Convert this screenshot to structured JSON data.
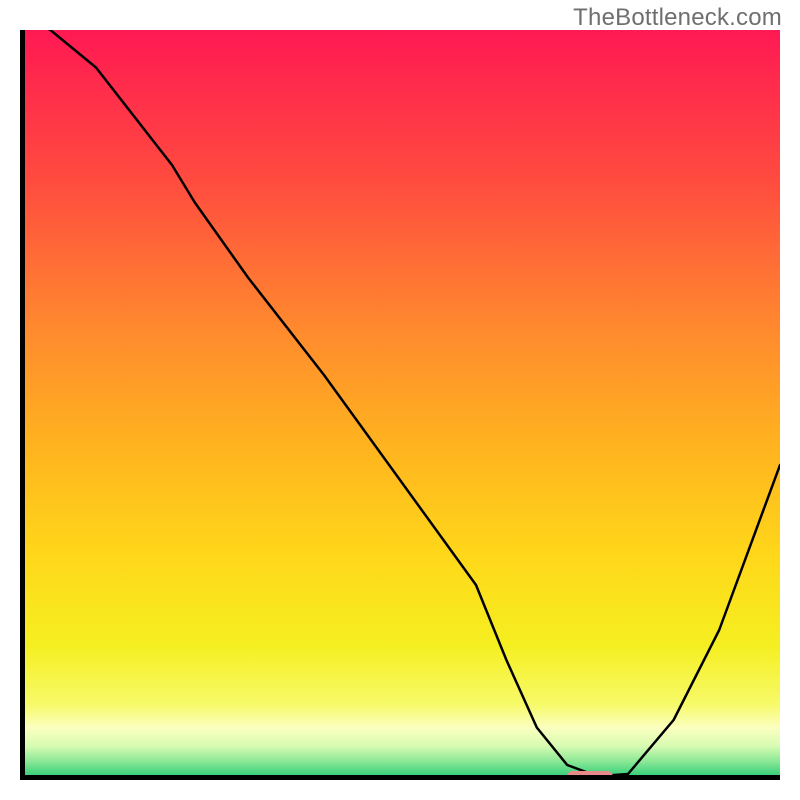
{
  "watermark": "TheBottleneck.com",
  "chart_data": {
    "type": "line",
    "title": "",
    "xlabel": "",
    "ylabel": "",
    "xlim": [
      0,
      100
    ],
    "ylim": [
      0,
      100
    ],
    "grid": false,
    "legend": false,
    "background": {
      "type": "vertical-gradient",
      "stops": [
        {
          "pos": 0.0,
          "color": "#ff1953"
        },
        {
          "pos": 0.2,
          "color": "#ff4b3f"
        },
        {
          "pos": 0.4,
          "color": "#ff8a2e"
        },
        {
          "pos": 0.55,
          "color": "#ffb21f"
        },
        {
          "pos": 0.7,
          "color": "#ffd71a"
        },
        {
          "pos": 0.82,
          "color": "#f5ef20"
        },
        {
          "pos": 0.9,
          "color": "#f7fa6a"
        },
        {
          "pos": 0.93,
          "color": "#fbffc0"
        },
        {
          "pos": 0.955,
          "color": "#d7fbb2"
        },
        {
          "pos": 0.975,
          "color": "#8be896"
        },
        {
          "pos": 1.0,
          "color": "#1ec771"
        }
      ]
    },
    "series": [
      {
        "name": "bottleneck-curve",
        "color": "#000000",
        "width": 2.5,
        "x": [
          0,
          4,
          10,
          20,
          23,
          30,
          40,
          50,
          60,
          64,
          68,
          72,
          76,
          80,
          86,
          92,
          100
        ],
        "y": [
          102,
          100,
          95,
          82,
          77,
          67,
          54,
          40,
          26,
          16,
          7,
          2,
          0.5,
          0.8,
          8,
          20,
          42
        ]
      }
    ],
    "annotations": [
      {
        "name": "optimal-marker",
        "type": "capsule",
        "x_center": 75,
        "y_center": 0.5,
        "width_x": 6,
        "height_y": 1.4,
        "fill": "#e88a8a"
      }
    ]
  }
}
